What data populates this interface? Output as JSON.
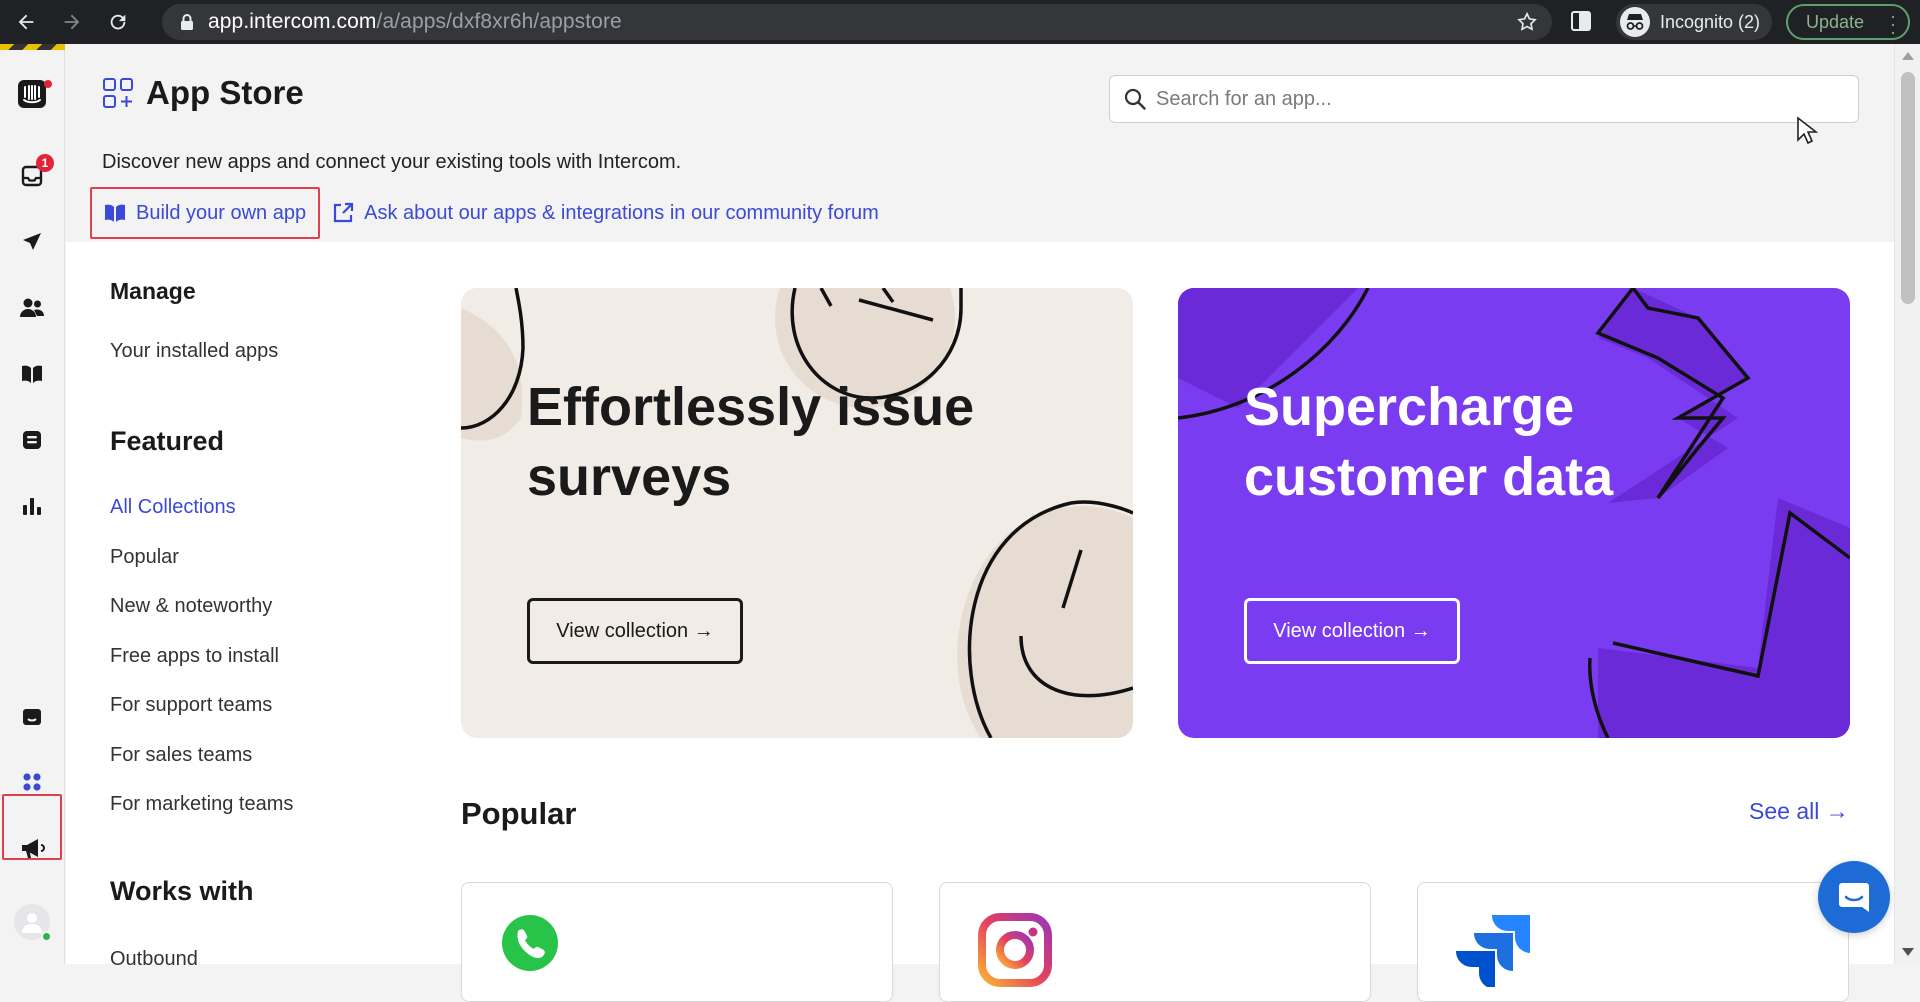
{
  "browser": {
    "url_host": "app.intercom.com",
    "url_path": "/a/apps/dxf8xr6h/appstore",
    "incognito_label": "Incognito (2)",
    "update_label": "Update"
  },
  "leftnav": {
    "inbox_badge": "1"
  },
  "header": {
    "title": "App Store",
    "subtitle": "Discover new apps and connect your existing tools with Intercom.",
    "build_link": "Build your own app",
    "forum_link": "Ask about our apps & integrations in our community forum"
  },
  "search": {
    "placeholder": "Search for an app..."
  },
  "sidebar": {
    "manage_heading": "Manage",
    "manage_items": [
      "Your installed apps"
    ],
    "featured_heading": "Featured",
    "featured_items": [
      "All Collections",
      "Popular",
      "New & noteworthy",
      "Free apps to install",
      "For support teams",
      "For sales teams",
      "For marketing teams"
    ],
    "works_heading": "Works with",
    "works_items": [
      "Outbound"
    ]
  },
  "banners": [
    {
      "heading": "Effortlessly issue surveys",
      "cta": "View collection →"
    },
    {
      "heading": "Supercharge customer data",
      "cta": "View collection →"
    }
  ],
  "popular": {
    "title": "Popular",
    "see_all": "See all →",
    "cards": [
      "whatsapp-icon",
      "instagram-icon",
      "jira-icon"
    ]
  },
  "colors": {
    "accent": "#3b4ad6",
    "purple_banner": "#7a3cf0",
    "beige_banner": "#f1ece6",
    "highlight": "#e03f4f"
  }
}
